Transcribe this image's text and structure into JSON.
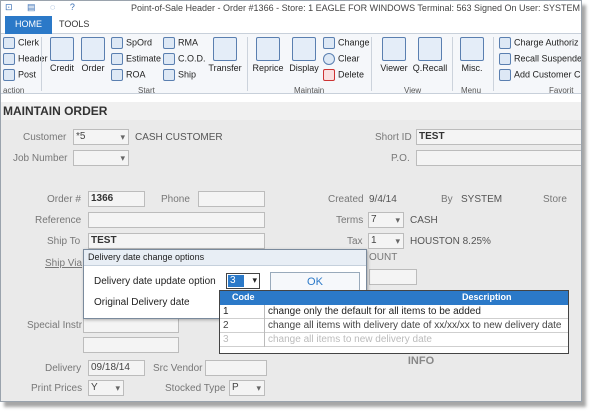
{
  "window": {
    "title": "Point-of-Sale Header - Order #1366 - Store: 1 EAGLE FOR WINDOWS Terminal: 563 Signed On User: SYSTEM",
    "quick_access": "⊡ ▤ ◌ ?"
  },
  "tabs": [
    {
      "label": "HOME",
      "active": true
    },
    {
      "label": "TOOLS",
      "active": false
    }
  ],
  "ribbon": {
    "left_stack": [
      "Clerk",
      "Header",
      "Post"
    ],
    "left_group_tail": "action",
    "credit": "Credit",
    "order": "Order",
    "small_start": [
      "SpOrd",
      "Estimate",
      "ROA"
    ],
    "small_start2": [
      "RMA",
      "C.O.D.",
      "Ship"
    ],
    "transfer": "Transfer",
    "start_group": "Start",
    "reprice": "Reprice",
    "display": "Display",
    "maintain_small": [
      "Change",
      "Clear",
      "Delete"
    ],
    "maintain_group": "Maintain",
    "viewer": "Viewer",
    "qrecall": "Q.Recall",
    "view_group": "View",
    "misc": "Misc.",
    "menu_group": "Menu",
    "favorites": [
      "Charge Authoriz",
      "Recall Suspende",
      "Add Customer C"
    ],
    "favorites_group": "Favorit"
  },
  "section_title": "MAINTAIN ORDER",
  "form": {
    "customer_label": "Customer",
    "customer_value": "*5",
    "customer_name": "CASH CUSTOMER",
    "short_id_label": "Short ID",
    "short_id_value": "TEST",
    "job_number_label": "Job Number",
    "po_label": "P.O.",
    "order_label": "Order #",
    "order_value": "1366",
    "phone_label": "Phone",
    "created_label": "Created",
    "created_value": "9/4/14",
    "by_label": "By",
    "by_value": "SYSTEM",
    "store_label": "Store",
    "reference_label": "Reference",
    "terms_label": "Terms",
    "terms_value": "7",
    "terms_name": "CASH",
    "ship_to_label": "Ship To",
    "ship_to_value": "TEST",
    "tax_label": "Tax",
    "tax_value": "1",
    "tax_name": "HOUSTON 8.25%",
    "ship_via_label": "Ship Via",
    "account_partial": "OUNT",
    "special_instr_label": "Special Instr",
    "delivery_label": "Delivery",
    "delivery_value": "09/18/14",
    "src_vendor_label": "Src Vendor",
    "print_prices_label": "Print Prices",
    "print_prices_value": "Y",
    "stocked_type_label": "Stocked Type",
    "stocked_type_value": "P",
    "info_label": "INFO"
  },
  "dialog": {
    "title": "Delivery date change options",
    "update_option_label": "Delivery date update option",
    "selected_value": "3",
    "ok_label": "OK",
    "original_delivery_label": "Original Delivery date",
    "grid_headers": {
      "code": "Code",
      "description": "Description"
    },
    "rows": [
      {
        "code": "1",
        "description": "change only the default for all items to be added"
      },
      {
        "code": "2",
        "description": "change all items with delivery date of xx/xx/xx to new delivery date"
      },
      {
        "code": "3",
        "description": "change all items to new delivery date"
      }
    ]
  }
}
